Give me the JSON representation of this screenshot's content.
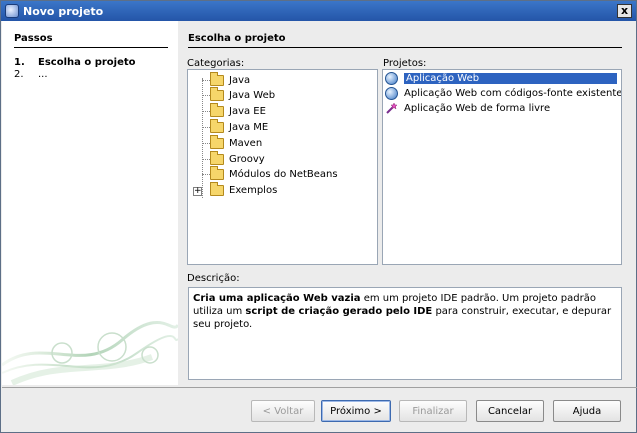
{
  "window": {
    "title": "Novo projeto",
    "close_label": "x"
  },
  "steps": {
    "title": "Passos",
    "items": [
      {
        "num": "1.",
        "label": "Escolha o projeto"
      },
      {
        "num": "2.",
        "label": "..."
      }
    ]
  },
  "main": {
    "title": "Escolha o projeto",
    "categories_label": "Categorias:",
    "projects_label": "Projetos:",
    "description_label": "Descrição:"
  },
  "categories": [
    {
      "label": "Java",
      "selected": false
    },
    {
      "label": "Java Web",
      "selected": false
    },
    {
      "label": "Java EE",
      "selected": false
    },
    {
      "label": "Java ME",
      "selected": false
    },
    {
      "label": "Maven",
      "selected": false
    },
    {
      "label": "Groovy",
      "selected": false
    },
    {
      "label": "Módulos do NetBeans",
      "selected": false
    },
    {
      "label": "Exemplos",
      "selected": false,
      "expander": "+"
    }
  ],
  "projects": [
    {
      "label": "Aplicação Web",
      "selected": true,
      "icon": "globe-icon"
    },
    {
      "label": "Aplicação Web com códigos-fonte existentes",
      "selected": false,
      "icon": "globe-icon"
    },
    {
      "label": "Aplicação Web de forma livre",
      "selected": false,
      "icon": "wand-icon"
    }
  ],
  "description": {
    "part1": "Cria uma aplicação Web vazia",
    "part2": " em um projeto IDE padrão. Um projeto padrão utiliza um ",
    "part3": "script de criação gerado pelo IDE",
    "part4": " para construir, executar, e depurar seu projeto."
  },
  "buttons": {
    "back": "< Voltar",
    "next": "Próximo >",
    "finish": "Finalizar",
    "cancel": "Cancelar",
    "help": "Ajuda"
  },
  "colors": {
    "title_bar": "#2d63c0",
    "selection": "#2d63c0"
  }
}
